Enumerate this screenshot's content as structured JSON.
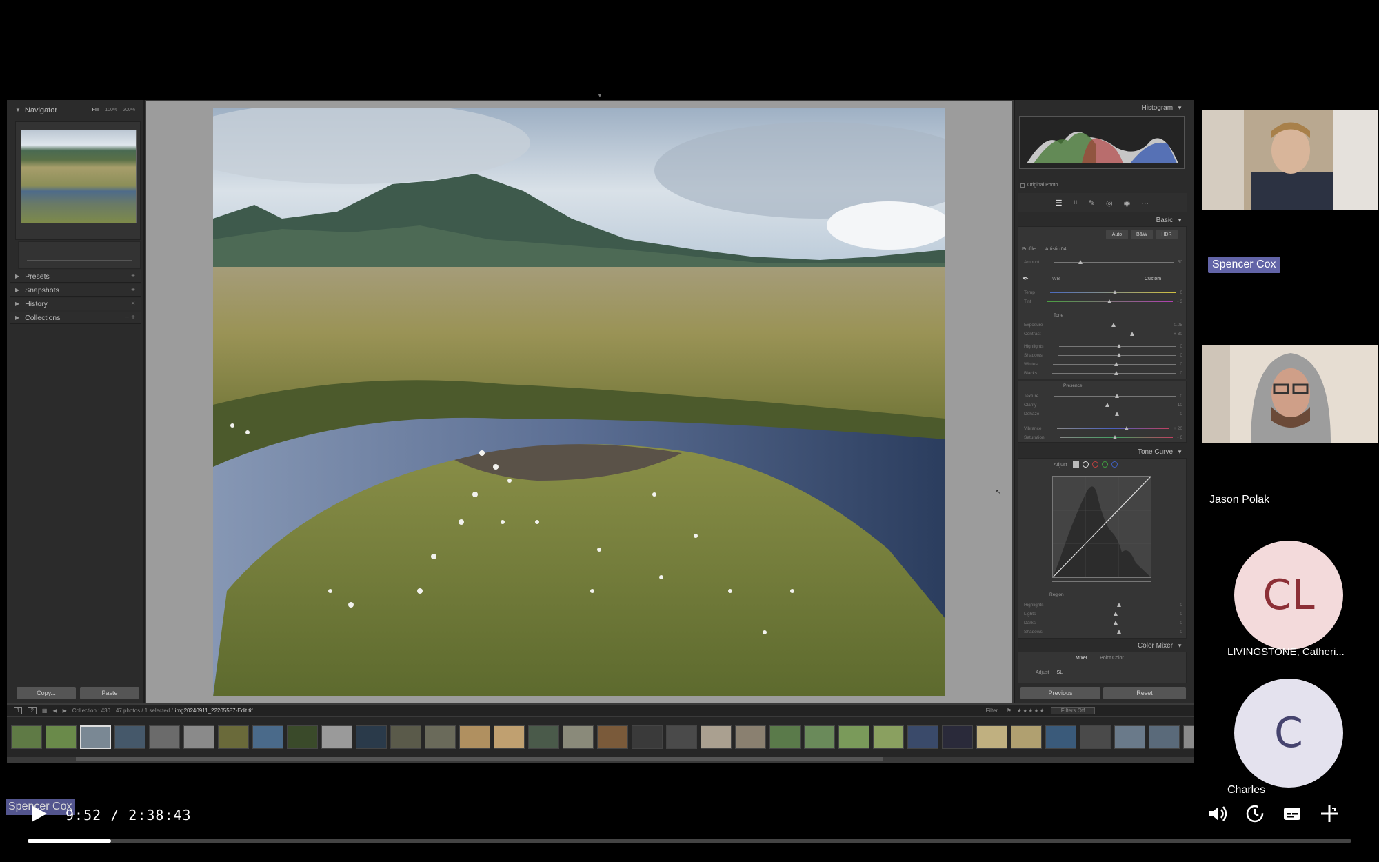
{
  "lightroom": {
    "navigator": {
      "title": "Navigator",
      "zoom_options": [
        "FIT",
        "100%",
        "200%"
      ]
    },
    "left_sections": [
      {
        "label": "Presets",
        "end": "+"
      },
      {
        "label": "Snapshots",
        "end": "+"
      },
      {
        "label": "History",
        "end": "×"
      },
      {
        "label": "Collections",
        "end": "− +"
      }
    ],
    "copy_label": "Copy...",
    "paste_label": "Paste",
    "histogram": {
      "title": "Histogram",
      "original_photo": "Original Photo"
    },
    "basic": {
      "title": "Basic",
      "modes": [
        "Auto",
        "B&W",
        "HDR"
      ],
      "profile_label": "Profile",
      "profile_value": "Artistic 04",
      "amount_label": "Amount",
      "amount_value": "50",
      "wb_label": "WB",
      "wb_value": "Custom",
      "temp_label": "Temp",
      "temp_value": "0",
      "tint_label": "Tint",
      "tint_value": "- 3",
      "tone_heading": "Tone",
      "exposure_label": "Exposure",
      "exposure_value": "- 0.05",
      "contrast_label": "Contrast",
      "contrast_value": "+ 30",
      "highlights_label": "Highlights",
      "highlights_value": "0",
      "shadows_label": "Shadows",
      "shadows_value": "0",
      "whites_label": "Whites",
      "whites_value": "0",
      "blacks_label": "Blacks",
      "blacks_value": "0",
      "presence_heading": "Presence",
      "texture_label": "Texture",
      "texture_value": "0",
      "clarity_label": "Clarity",
      "clarity_value": "- 10",
      "dehaze_label": "Dehaze",
      "dehaze_value": "0",
      "vibrance_label": "Vibrance",
      "vibrance_value": "+ 20",
      "saturation_label": "Saturation",
      "saturation_value": "- 6"
    },
    "tone_curve": {
      "title": "Tone Curve",
      "adjust_label": "Adjust",
      "region_heading": "Region",
      "highlights_label": "Highlights",
      "lights_label": "Lights",
      "darks_label": "Darks",
      "shadows_label": "Shadows"
    },
    "color_mixer": {
      "title": "Color Mixer",
      "tabs": [
        "Mixer",
        "Point Color"
      ],
      "adjust_label": "Adjust",
      "adjust_value": "HSL"
    },
    "previous_label": "Previous",
    "reset_label": "Reset",
    "filmstrip": {
      "collection_label": "Collection : #30",
      "photos_info": "47 photos / 1 selected /",
      "filename": "img20240911_22205587-Edit.tif",
      "filter_label": "Filter :",
      "filter_value": "Filters Off"
    }
  },
  "call": {
    "participants": [
      {
        "name": "Spencer Cox"
      },
      {
        "name": "Jason Polak"
      },
      {
        "name": "LIVINGSTONE, Catheri...",
        "initials": "CL",
        "color": "#f3dadb",
        "text_color": "#8c2f36"
      },
      {
        "name": "Charles",
        "initials": "C",
        "color": "#e4e2ee",
        "text_color": "#45436e"
      }
    ],
    "speaker_caption": "Spencer Cox"
  },
  "player": {
    "time": "9:52 / 2:38:43",
    "progress_fraction": 0.063
  }
}
